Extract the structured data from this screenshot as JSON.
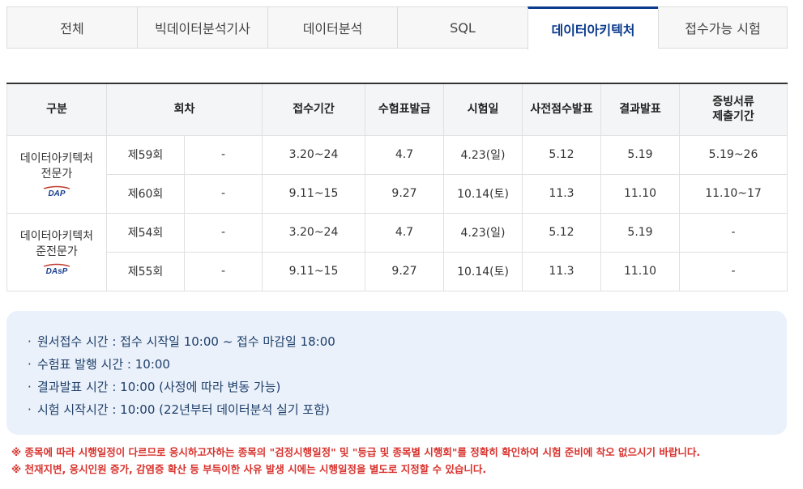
{
  "tabs": [
    {
      "label": "전체",
      "active": false
    },
    {
      "label": "빅데이터분석기사",
      "active": false
    },
    {
      "label": "데이터분석",
      "active": false
    },
    {
      "label": "SQL",
      "active": false
    },
    {
      "label": "데이터아키텍처",
      "active": true
    },
    {
      "label": "접수가능 시험",
      "active": false
    }
  ],
  "table": {
    "headers": {
      "category": "구분",
      "round": "회차",
      "application": "접수기간",
      "ticket": "수험표발급",
      "exam_date": "시험일",
      "pre_result": "사전점수발표",
      "result": "결과발표",
      "doc_title_1": "증빙서류",
      "doc_title_2": "제출기간"
    },
    "groups": [
      {
        "name_line1": "데이터아키텍처",
        "name_line2": "전문가",
        "logo_text": "DAP",
        "rows": [
          {
            "round": "제59회",
            "sub": "-",
            "application": "3.20~24",
            "ticket": "4.7",
            "exam_date": "4.23(일)",
            "pre_result": "5.12",
            "result": "5.19",
            "docs": "5.19~26"
          },
          {
            "round": "제60회",
            "sub": "-",
            "application": "9.11~15",
            "ticket": "9.27",
            "exam_date": "10.14(토)",
            "pre_result": "11.3",
            "result": "11.10",
            "docs": "11.10~17"
          }
        ]
      },
      {
        "name_line1": "데이터아키텍처",
        "name_line2": "준전문가",
        "logo_text": "DAsP",
        "rows": [
          {
            "round": "제54회",
            "sub": "-",
            "application": "3.20~24",
            "ticket": "4.7",
            "exam_date": "4.23(일)",
            "pre_result": "5.12",
            "result": "5.19",
            "docs": "-"
          },
          {
            "round": "제55회",
            "sub": "-",
            "application": "9.11~15",
            "ticket": "9.27",
            "exam_date": "10.14(토)",
            "pre_result": "11.3",
            "result": "11.10",
            "docs": "-"
          }
        ]
      }
    ]
  },
  "notice": {
    "bullet": "·",
    "items": [
      "원서접수 시간 : 접수 시작일 10:00 ~ 접수 마감일 18:00",
      "수험표 발행 시간 : 10:00",
      "결과발표 시간 : 10:00 (사정에 따라 변동 가능)",
      "시험 시작시간 : 10:00 (22년부터 데이터분석 실기 포함)"
    ]
  },
  "warnings": [
    "※ 종목에 따라 시행일정이 다르므로 응시하고자하는 종목의 \"검정시행일정\" 및 \"등급 및 종목별 시행회\"를 정확히 확인하여 시험 준비에 착오 없으시기 바랍니다.",
    "※ 천재지변, 응시인원 증가, 감염증 확산 등 부득이한 사유 발생 시에는 시행일정을 별도로 지정할 수 있습니다."
  ],
  "colors": {
    "accent": "#0b3b8c",
    "warning": "#d8322d",
    "notice_bg": "#eaf1fa",
    "notice_text": "#1f3f6a"
  }
}
